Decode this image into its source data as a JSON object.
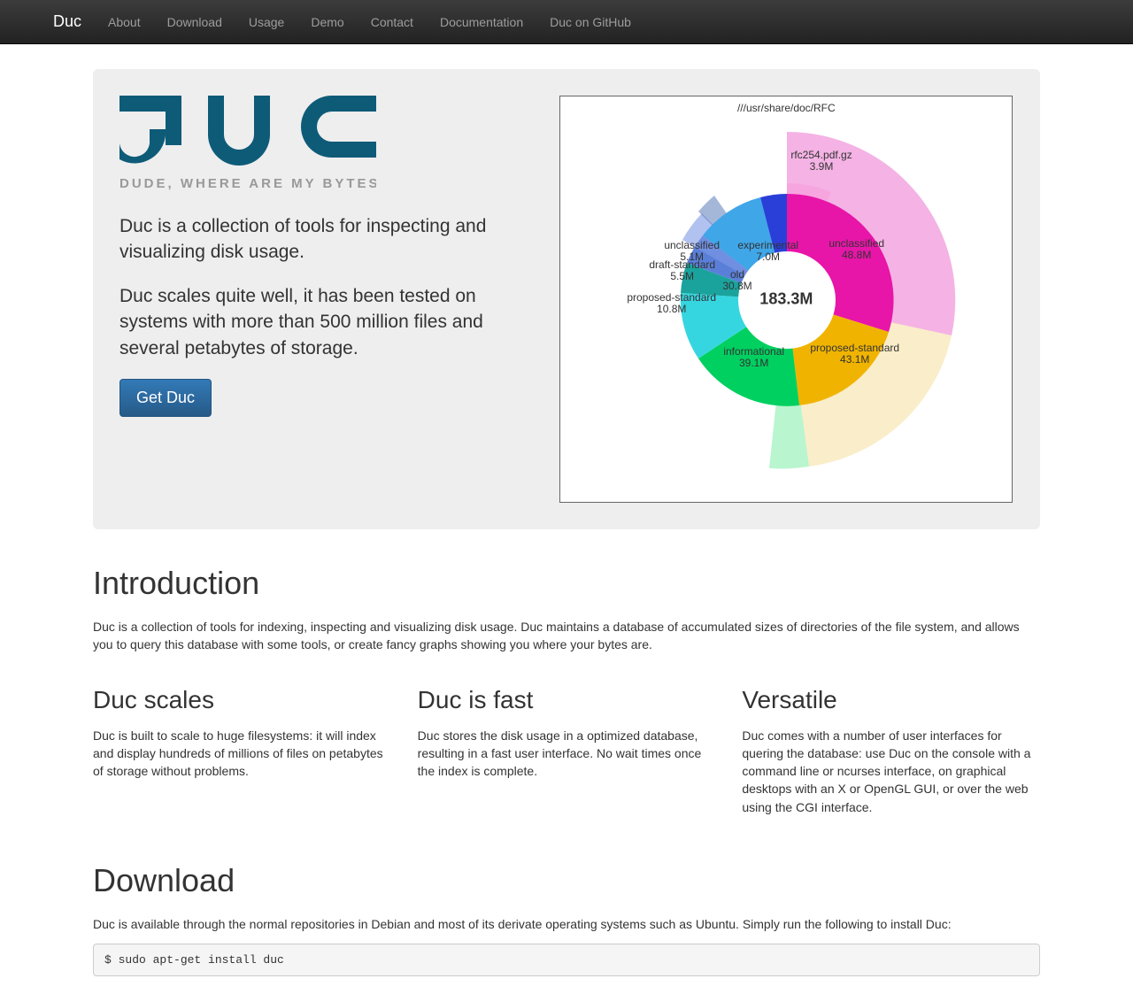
{
  "nav": {
    "brand": "Duc",
    "items": [
      "About",
      "Download",
      "Usage",
      "Demo",
      "Contact",
      "Documentation",
      "Duc on GitHub"
    ]
  },
  "logo": {
    "main": "DUC",
    "sub": "DUDE, WHERE ARE MY BYTES"
  },
  "hero": {
    "lead1": "Duc is a collection of tools for inspecting and visualizing disk usage.",
    "lead2": "Duc scales quite well, it has been tested on systems with more than 500 million files and several petabytes of storage.",
    "cta": "Get Duc"
  },
  "chart_data": {
    "type": "pie",
    "title": "///usr/share/doc/RFC",
    "center_value": "183.3M",
    "segments": [
      {
        "label": "unclassified",
        "value": 48.8,
        "unit": "M",
        "color": "#e815a9"
      },
      {
        "label": "proposed-standard",
        "value": 43.1,
        "unit": "M",
        "color": "#f0b400"
      },
      {
        "label": "informational",
        "value": 39.1,
        "unit": "M",
        "color": "#00d060"
      },
      {
        "label": "proposed-standard",
        "value": 10.8,
        "unit": "M",
        "color": "#36d6e0"
      },
      {
        "label": "draft-standard",
        "value": 5.5,
        "unit": "M",
        "color": "#1aa39c"
      },
      {
        "label": "unclassified",
        "value": 5.1,
        "unit": "M",
        "color": "#5a7fd8"
      },
      {
        "label": "old",
        "value": 30.8,
        "unit": "M",
        "color": "#3fa6e8"
      },
      {
        "label": "experimental",
        "value": 7.0,
        "unit": "M",
        "color": "#2a3fd8"
      }
    ],
    "outer_annotations": [
      {
        "label": "rfc254.pdf.gz",
        "value": 3.9,
        "unit": "M"
      }
    ]
  },
  "intro": {
    "heading": "Introduction",
    "p": "Duc is a collection of tools for indexing, inspecting and visualizing disk usage. Duc maintains a database of accumulated sizes of directories of the file system, and allows you to query this database with some tools, or create fancy graphs showing you where your bytes are."
  },
  "features": [
    {
      "h": "Duc scales",
      "p": "Duc is built to scale to huge filesystems: it will index and display hundreds of millions of files on petabytes of storage without problems."
    },
    {
      "h": "Duc is fast",
      "p": "Duc stores the disk usage in a optimized database, resulting in a fast user interface. No wait times once the index is complete."
    },
    {
      "h": "Versatile",
      "p": "Duc comes with a number of user interfaces for quering the database: use Duc on the console with a command line or ncurses interface, on graphical desktops with an X or OpenGL GUI, or over the web using the CGI interface."
    }
  ],
  "download": {
    "heading": "Download",
    "p": "Duc is available through the normal repositories in Debian and most of its derivate operating systems such as Ubuntu. Simply run the following to install Duc:",
    "cmd": "$ sudo apt-get install duc"
  }
}
